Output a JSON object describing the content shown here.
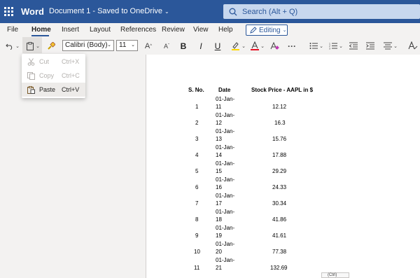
{
  "titlebar": {
    "app_name": "Word",
    "doc_title": "Document 1 - Saved to OneDrive",
    "search_placeholder": "Search (Alt + Q)",
    "bg_color": "#2b579a"
  },
  "menu_tabs": [
    {
      "label": "File"
    },
    {
      "label": "Home",
      "active": true
    },
    {
      "label": "Insert"
    },
    {
      "label": "Layout"
    },
    {
      "label": "References"
    },
    {
      "label": "Review"
    },
    {
      "label": "View"
    },
    {
      "label": "Help"
    }
  ],
  "mode_button": {
    "label": "Editing"
  },
  "toolbar": {
    "font_name": "Calibri (Body)",
    "font_size": "11",
    "bold": "B",
    "italic": "I",
    "underline": "U",
    "grow_font": "A",
    "shrink_font": "A",
    "more": "···"
  },
  "clipboard_menu": {
    "items": [
      {
        "label": "Cut",
        "shortcut": "Ctrl+X",
        "enabled": false,
        "icon": "scissors-icon"
      },
      {
        "label": "Copy",
        "shortcut": "Ctrl+C",
        "enabled": false,
        "icon": "copy-icon"
      },
      {
        "label": "Paste",
        "shortcut": "Ctrl+V",
        "enabled": true,
        "icon": "paste-icon"
      }
    ]
  },
  "document_table": {
    "headers": [
      "S. No.",
      "Date",
      "Stock Price - AAPL in $"
    ],
    "rows": [
      {
        "sno": "1",
        "date_line1": "01-Jan-",
        "date_line2": "11",
        "price": "12.12"
      },
      {
        "sno": "2",
        "date_line1": "01-Jan-",
        "date_line2": "12",
        "price": "16.3"
      },
      {
        "sno": "3",
        "date_line1": "01-Jan-",
        "date_line2": "13",
        "price": "15.76"
      },
      {
        "sno": "4",
        "date_line1": "01-Jan-",
        "date_line2": "14",
        "price": "17.88"
      },
      {
        "sno": "5",
        "date_line1": "01-Jan-",
        "date_line2": "15",
        "price": "29.29"
      },
      {
        "sno": "6",
        "date_line1": "01-Jan-",
        "date_line2": "16",
        "price": "24.33"
      },
      {
        "sno": "7",
        "date_line1": "01-Jan-",
        "date_line2": "17",
        "price": "30.34"
      },
      {
        "sno": "8",
        "date_line1": "01-Jan-",
        "date_line2": "18",
        "price": "41.86"
      },
      {
        "sno": "9",
        "date_line1": "01-Jan-",
        "date_line2": "19",
        "price": "41.61"
      },
      {
        "sno": "10",
        "date_line1": "01-Jan-",
        "date_line2": "20",
        "price": "77.38"
      },
      {
        "sno": "11",
        "date_line1": "01-Jan-",
        "date_line2": "21",
        "price": "132.69"
      }
    ]
  },
  "paste_options_tag": "(Ctrl)"
}
